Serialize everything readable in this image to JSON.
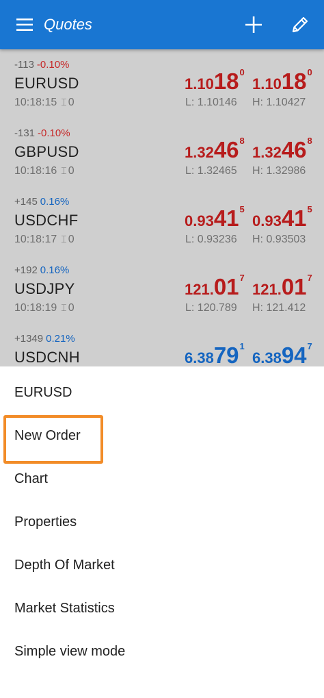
{
  "header": {
    "title": "Quotes",
    "background": "#1976d2",
    "icons": [
      "menu-icon",
      "add-icon",
      "edit-icon"
    ]
  },
  "quotes": [
    {
      "change_points": "-113",
      "change_percent": "-0.10%",
      "direction": "down",
      "symbol": "EURUSD",
      "time": "10:18:15",
      "spread": "0",
      "bid": {
        "base": "1.10",
        "big": "18",
        "sup": "0"
      },
      "ask": {
        "base": "1.10",
        "big": "18",
        "sup": "0"
      },
      "low": "L: 1.10146",
      "high": "H: 1.10427"
    },
    {
      "change_points": "-131",
      "change_percent": "-0.10%",
      "direction": "down",
      "symbol": "GBPUSD",
      "time": "10:18:16",
      "spread": "0",
      "bid": {
        "base": "1.32",
        "big": "46",
        "sup": "8"
      },
      "ask": {
        "base": "1.32",
        "big": "46",
        "sup": "8"
      },
      "low": "L: 1.32465",
      "high": "H: 1.32986"
    },
    {
      "change_points": "+145",
      "change_percent": "0.16%",
      "direction": "up",
      "symbol": "USDCHF",
      "time": "10:18:17",
      "spread": "0",
      "bid": {
        "base": "0.93",
        "big": "41",
        "sup": "5"
      },
      "ask": {
        "base": "0.93",
        "big": "41",
        "sup": "5"
      },
      "low": "L: 0.93236",
      "high": "H: 0.93503"
    },
    {
      "change_points": "+192",
      "change_percent": "0.16%",
      "direction": "up",
      "symbol": "USDJPY",
      "time": "10:18:19",
      "spread": "0",
      "bid": {
        "base": "121.",
        "big": "01",
        "sup": "7"
      },
      "ask": {
        "base": "121.",
        "big": "01",
        "sup": "7"
      },
      "low": "L: 120.789",
      "high": "H: 121.412"
    },
    {
      "change_points": "+1349",
      "change_percent": "0.21%",
      "direction": "up",
      "symbol": "USDCNH",
      "time": "",
      "spread": "",
      "bid": {
        "base": "6.38",
        "big": "79",
        "sup": "1"
      },
      "ask": {
        "base": "6.38",
        "big": "94",
        "sup": "7"
      },
      "low": "",
      "high": ""
    }
  ],
  "context_menu": {
    "items": [
      {
        "label": "EURUSD"
      },
      {
        "label": "New Order"
      },
      {
        "label": "Chart"
      },
      {
        "label": "Properties"
      },
      {
        "label": "Depth Of Market"
      },
      {
        "label": "Market Statistics"
      },
      {
        "label": "Simple view mode"
      }
    ],
    "highlighted_item": "New Order",
    "highlight_color": "#f28c28"
  },
  "colors": {
    "price_down": "#b71c1c",
    "price_up": "#1565c0",
    "overlay": "#cfcfcf"
  }
}
